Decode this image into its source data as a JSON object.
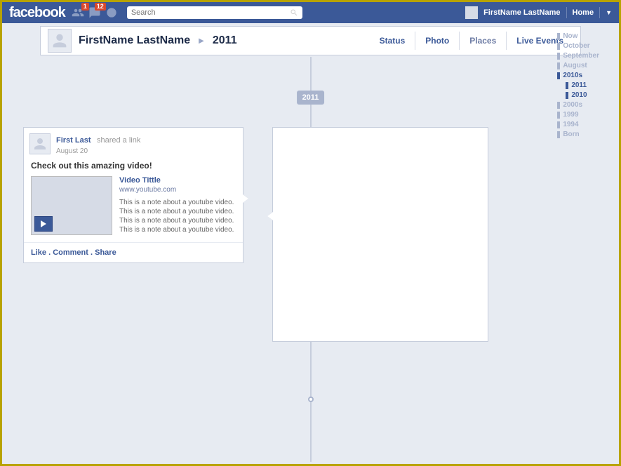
{
  "brand": "facebook",
  "search": {
    "placeholder": "Search"
  },
  "notifications": {
    "friends": "1",
    "messages": "12"
  },
  "user": {
    "full_name": "FirstName LastName"
  },
  "nav": {
    "home": "Home"
  },
  "profile": {
    "name": "FirstName LastName",
    "year": "2011"
  },
  "tabs": [
    {
      "label": "Status"
    },
    {
      "label": "Photo"
    },
    {
      "label": "Places"
    },
    {
      "label": "Live Events"
    }
  ],
  "timeline_year_marker": "2011",
  "date_nav": [
    {
      "label": "Now",
      "active": false,
      "sub": false
    },
    {
      "label": "October",
      "active": false,
      "sub": false
    },
    {
      "label": "September",
      "active": false,
      "sub": false
    },
    {
      "label": "August",
      "active": false,
      "sub": false
    },
    {
      "label": "2010s",
      "active": true,
      "sub": false
    },
    {
      "label": "2011",
      "active": true,
      "sub": true
    },
    {
      "label": "2010",
      "active": true,
      "sub": true
    },
    {
      "label": "2000s",
      "active": false,
      "sub": false
    },
    {
      "label": "1999",
      "active": false,
      "sub": false
    },
    {
      "label": "1994",
      "active": false,
      "sub": false
    },
    {
      "label": "Born",
      "active": false,
      "sub": false
    }
  ],
  "post": {
    "author": "First Last",
    "action_text": "shared a link",
    "date": "August 20",
    "text": "Check out this amazing video!",
    "video": {
      "title": "Video Tittle",
      "url": "www.youtube.com",
      "desc": "This is a note about a youtube video.\nThis is a note about a youtube video.\nThis is a note about a youtube video.\nThis is a note about a youtube video."
    },
    "actions": {
      "like": "Like",
      "comment": "Comment",
      "share": "Share",
      "sep": " . "
    }
  }
}
